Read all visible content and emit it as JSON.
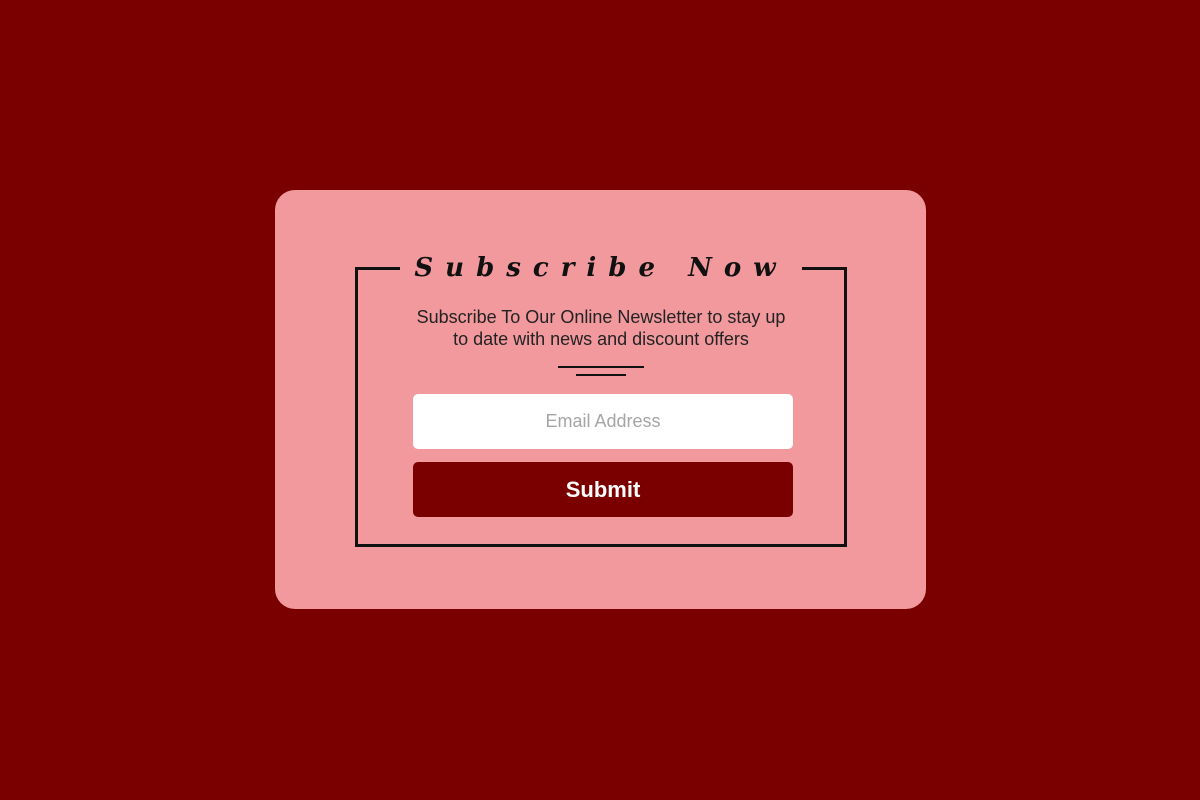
{
  "colors": {
    "page_background": "#7a0000",
    "card_background": "#f2999e",
    "frame_border": "#111111",
    "button_background": "#7a0000",
    "button_text": "#ffffff",
    "input_background": "#ffffff",
    "placeholder_text": "#a5a5a5"
  },
  "subscribe": {
    "title": "Subscribe Now",
    "description": "Subscribe To Our Online Newsletter to stay up to date with news and discount offers",
    "email_placeholder": "Email Address",
    "email_value": "",
    "submit_label": "Submit"
  }
}
